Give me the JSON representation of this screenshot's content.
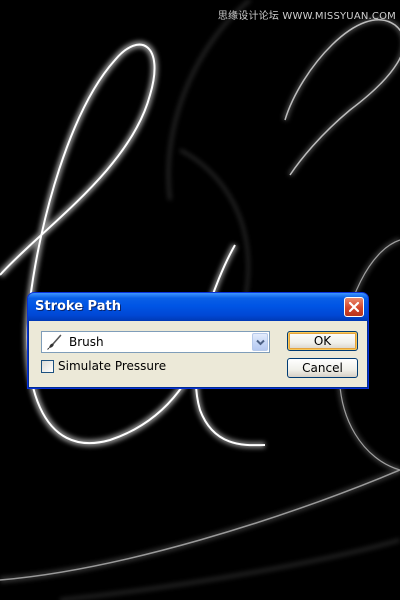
{
  "watermark": "思缘设计论坛 WWW.MISSYUAN.COM",
  "dialog": {
    "title": "Stroke Path",
    "tool": {
      "selected": "Brush",
      "icon": "brush-icon"
    },
    "simulate_pressure": {
      "label": "Simulate Pressure",
      "checked": false
    },
    "ok_label": "OK",
    "cancel_label": "Cancel",
    "title_color": "#0055e5"
  }
}
